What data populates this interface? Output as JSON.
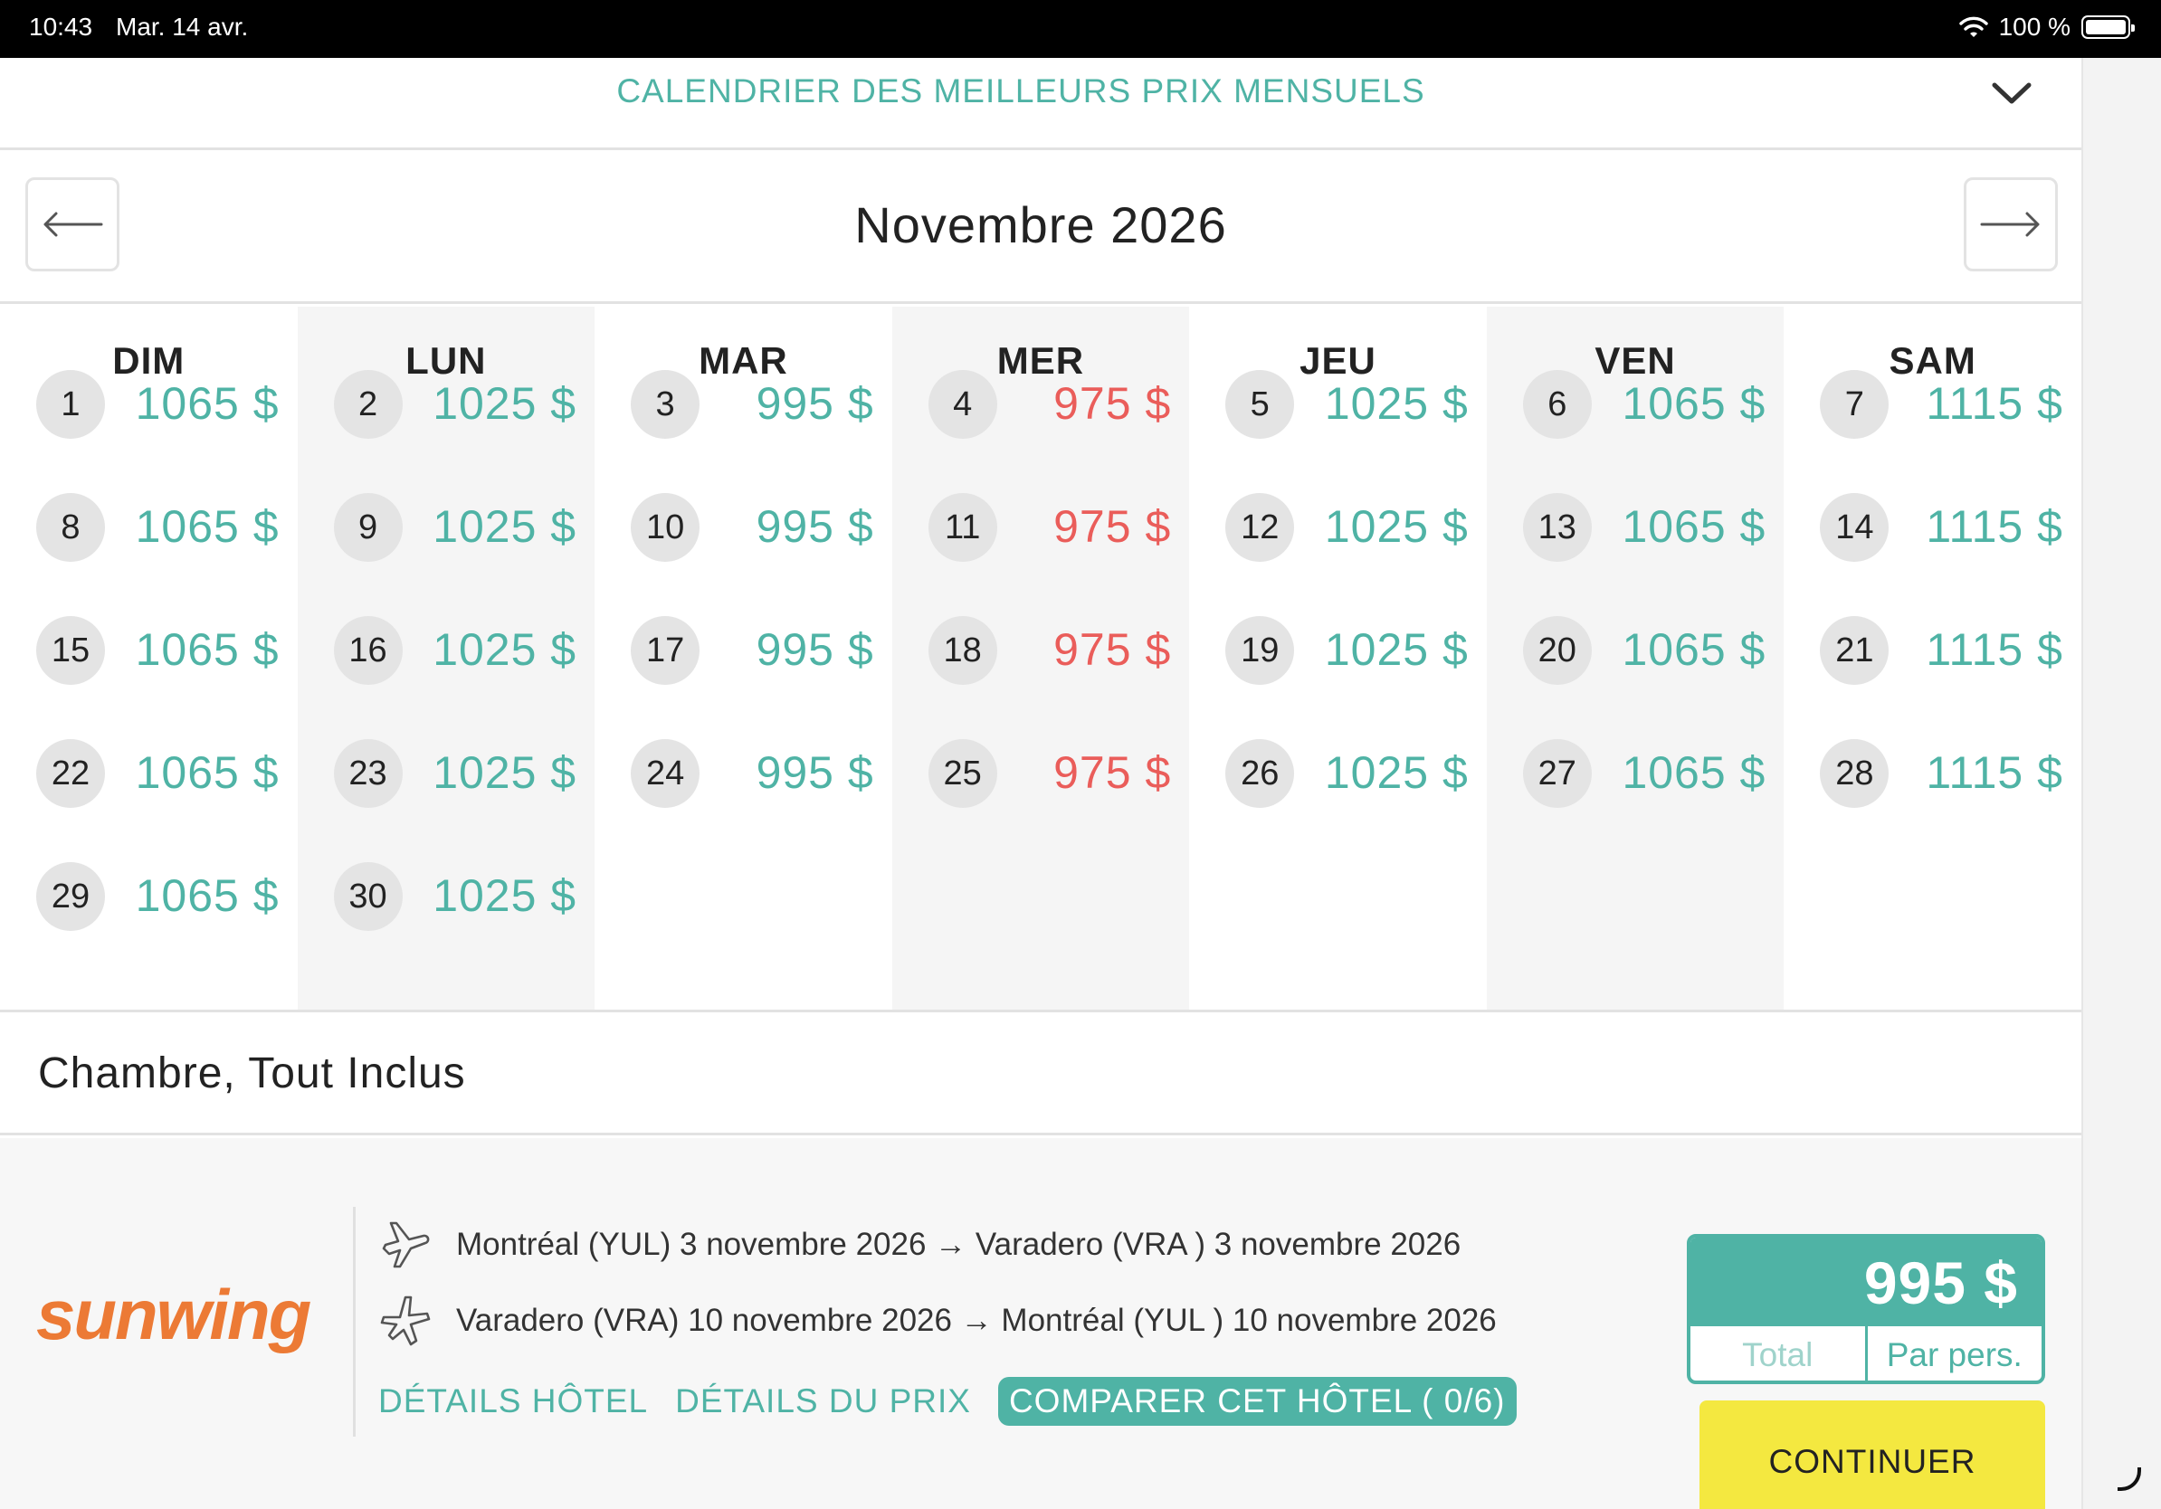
{
  "status_bar": {
    "time": "10:43",
    "date": "Mar. 14 avr.",
    "battery": "100 %"
  },
  "header": {
    "title": "CALENDRIER DES MEILLEURS PRIX MENSUELS",
    "collapse_icon": "chevron-down-icon"
  },
  "calendar": {
    "month": "Novembre 2026",
    "prev_icon": "arrow-left-icon",
    "next_icon": "arrow-right-icon",
    "days": [
      "DIM",
      "LUN",
      "MAR",
      "MER",
      "JEU",
      "VEN",
      "SAM"
    ],
    "price_color": "#4fb3a5",
    "low_price_color": "#ea5d5a",
    "rows": [
      [
        [
          "1",
          "1065 $"
        ],
        [
          "2",
          "1025 $"
        ],
        [
          "3",
          "995 $"
        ],
        [
          "4",
          "975 $"
        ],
        [
          "5",
          "1025 $"
        ],
        [
          "6",
          "1065 $"
        ],
        [
          "7",
          "1115 $"
        ]
      ],
      [
        [
          "8",
          "1065 $"
        ],
        [
          "9",
          "1025 $"
        ],
        [
          "10",
          "995 $"
        ],
        [
          "11",
          "975 $"
        ],
        [
          "12",
          "1025 $"
        ],
        [
          "13",
          "1065 $"
        ],
        [
          "14",
          "1115 $"
        ]
      ],
      [
        [
          "15",
          "1065 $"
        ],
        [
          "16",
          "1025 $"
        ],
        [
          "17",
          "995 $"
        ],
        [
          "18",
          "975 $"
        ],
        [
          "19",
          "1025 $"
        ],
        [
          "20",
          "1065 $"
        ],
        [
          "21",
          "1115 $"
        ]
      ],
      [
        [
          "22",
          "1065 $"
        ],
        [
          "23",
          "1025 $"
        ],
        [
          "24",
          "995 $"
        ],
        [
          "25",
          "975 $"
        ],
        [
          "26",
          "1025 $"
        ],
        [
          "27",
          "1065 $"
        ],
        [
          "28",
          "1115 $"
        ]
      ],
      [
        [
          "29",
          "1065 $"
        ],
        [
          "30",
          "1025 $"
        ]
      ]
    ]
  },
  "room": {
    "title": "Chambre, Tout Inclus"
  },
  "offer": {
    "brand": "sunwing",
    "brand_color": "#ec7a35",
    "outbound": "Montréal (YUL) 3 novembre 2026 → Varadero (VRA ) 3 novembre 2026",
    "return": "Varadero (VRA) 10 novembre 2026 → Montréal (YUL ) 10 novembre 2026",
    "link_hotel": "DÉTAILS HÔTEL",
    "link_price": "DÉTAILS DU PRIX",
    "compare": "COMPARER CET HÔTEL ( 0/6)",
    "price": "995 $",
    "toggle_total": "Total",
    "toggle_per_person": "Par pers.",
    "continue": "CONTINUER",
    "continue_color": "#f4e840"
  }
}
